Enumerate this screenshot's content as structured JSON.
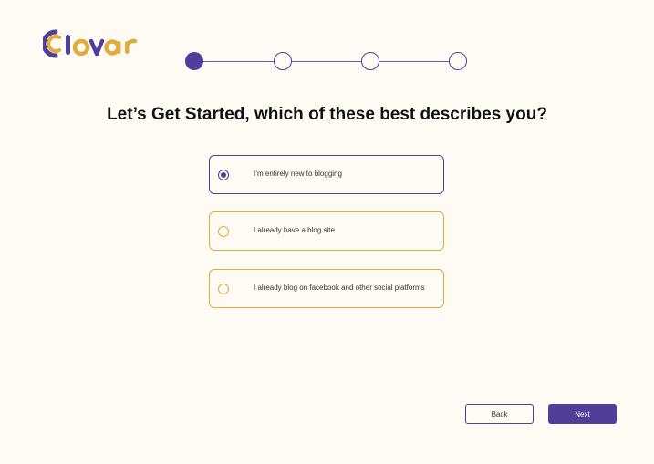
{
  "brand": {
    "name": "Clovar",
    "primary": "#4f3f9a",
    "accent": "#e0ac3e",
    "background": "#fdfbf3"
  },
  "stepper": {
    "current_step": 1,
    "total_steps": 4
  },
  "title": "Let’s Get Started, which of these best describes you?",
  "options": [
    {
      "label": "I’m entirely new to blogging",
      "selected": true
    },
    {
      "label": "I already have a blog site",
      "selected": false
    },
    {
      "label": "I already blog on facebook and other social platforms",
      "selected": false
    }
  ],
  "buttons": {
    "back": "Back",
    "next": "Next"
  }
}
